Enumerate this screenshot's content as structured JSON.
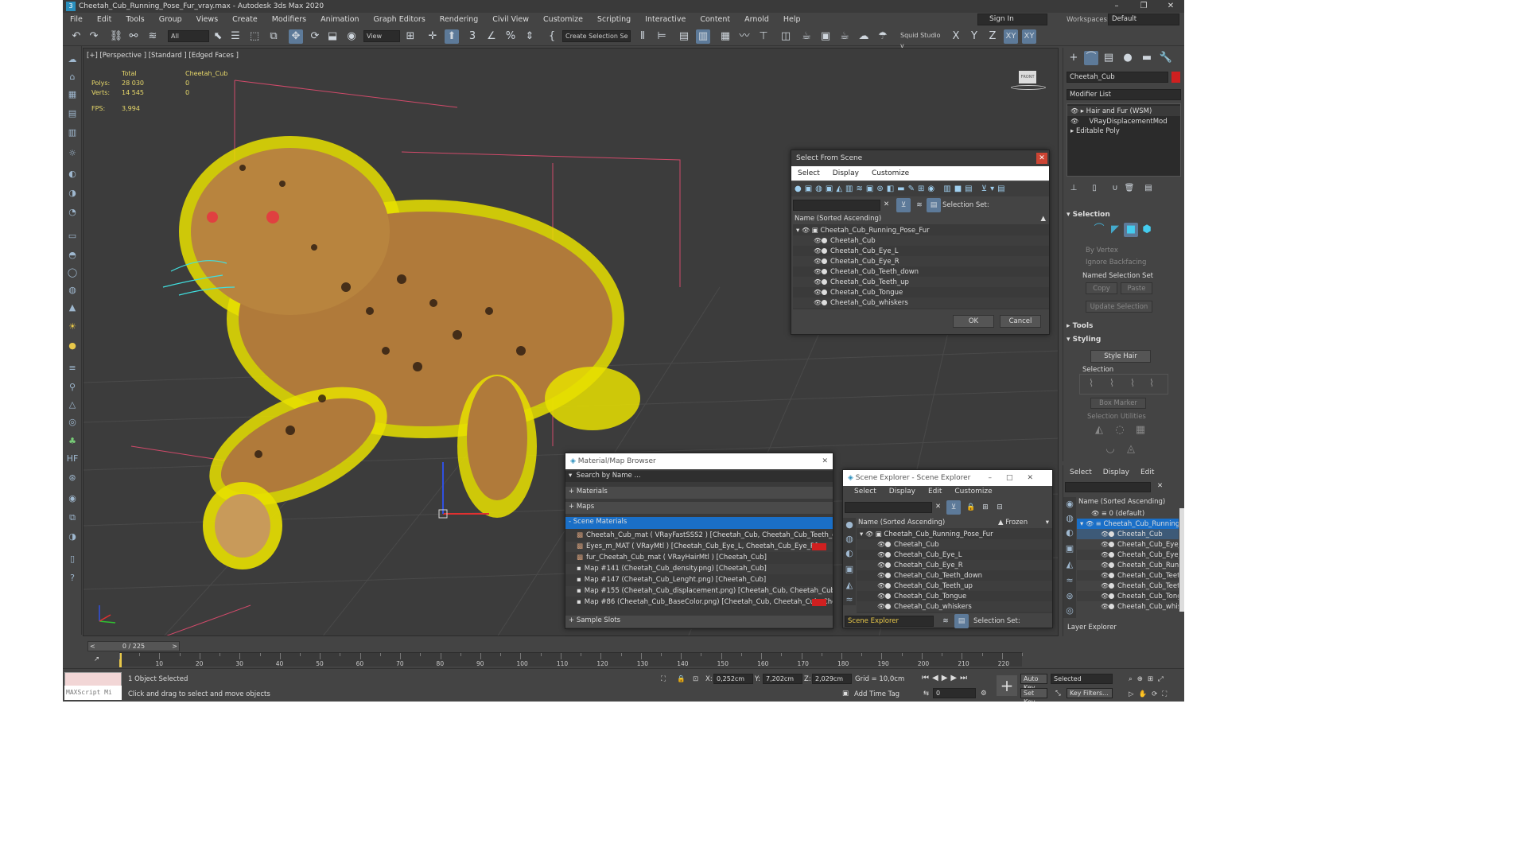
{
  "window": {
    "title": "Cheetah_Cub_Running_Pose_Fur_vray.max - Autodesk 3ds Max 2020",
    "min": "–",
    "max": "❐",
    "close": "✕"
  },
  "menu": [
    "File",
    "Edit",
    "Tools",
    "Group",
    "Views",
    "Create",
    "Modifiers",
    "Animation",
    "Graph Editors",
    "Rendering",
    "Civil View",
    "Customize",
    "Scripting",
    "Interactive",
    "Content",
    "Arnold",
    "Help"
  ],
  "account": {
    "signin": "Sign In",
    "workspaces_label": "Workspaces:",
    "workspace": "Default"
  },
  "toolbar": {
    "filter": "All",
    "refcoord": "View",
    "selset": "Create Selection Se",
    "squid": "Squid Studio v",
    "axes": [
      "X",
      "Y",
      "Z",
      "XY",
      "XY"
    ]
  },
  "viewport": {
    "label": "[+] [Perspective ] [Standard ] [Edged Faces ]",
    "stats": {
      "total_label": "Total",
      "object": "Cheetah_Cub",
      "polys_label": "Polys:",
      "polys_total": "28 030",
      "polys_obj": "0",
      "verts_label": "Verts:",
      "verts_total": "14 545",
      "verts_obj": "0",
      "fps_label": "FPS:",
      "fps": "3,994"
    },
    "viewcube": "FRONT"
  },
  "select_from_scene": {
    "title": "Select From Scene",
    "menu": [
      "Select",
      "Display",
      "Customize"
    ],
    "selection_set": "Selection Set:",
    "column": "Name (Sorted Ascending)",
    "root": "Cheetah_Cub_Running_Pose_Fur",
    "items": [
      "Cheetah_Cub",
      "Cheetah_Cub_Eye_L",
      "Cheetah_Cub_Eye_R",
      "Cheetah_Cub_Teeth_down",
      "Cheetah_Cub_Teeth_up",
      "Cheetah_Cub_Tongue",
      "Cheetah_Cub_whiskers"
    ],
    "ok": "OK",
    "cancel": "Cancel"
  },
  "material_browser": {
    "title": "Material/Map Browser",
    "search": "Search by Name ...",
    "sections": {
      "materials": "+ Materials",
      "maps": "+ Maps",
      "scene": "- Scene Materials",
      "samples": "+ Sample Slots"
    },
    "items": [
      "Cheetah_Cub_mat  ( VRayFastSSS2 )  [Cheetah_Cub, Cheetah_Cub_Teeth_do...",
      "Eyes_m_MAT  ( VRayMtl )  [Cheetah_Cub_Eye_L, Cheetah_Cub_Eye_R]",
      "fur_Cheetah_Cub_mat  ( VRayHairMtl )  [Cheetah_Cub]",
      "Map #141 (Cheetah_Cub_density.png)  [Cheetah_Cub]",
      "Map #147 (Cheetah_Cub_Lenght.png)  [Cheetah_Cub]",
      "Map #155 (Cheetah_Cub_displacement.png)  [Cheetah_Cub, Cheetah_Cub, C...",
      "Map #86 (Cheetah_Cub_BaseColor.png)  [Cheetah_Cub, Cheetah_Cub, Cheet..."
    ]
  },
  "scene_explorer": {
    "title": "Scene Explorer - Scene Explorer",
    "menu": [
      "Select",
      "Display",
      "Edit",
      "Customize"
    ],
    "column": "Name (Sorted Ascending)",
    "frozen": "▲ Frozen",
    "root": "Cheetah_Cub_Running_Pose_Fur",
    "items": [
      "Cheetah_Cub",
      "Cheetah_Cub_Eye_L",
      "Cheetah_Cub_Eye_R",
      "Cheetah_Cub_Teeth_down",
      "Cheetah_Cub_Teeth_up",
      "Cheetah_Cub_Tongue",
      "Cheetah_Cub_whiskers"
    ],
    "footer": "Scene Explorer",
    "selection_set": "Selection Set:"
  },
  "command_panel": {
    "object_name": "Cheetah_Cub",
    "modifier_list": "Modifier List",
    "stack": [
      "Hair and Fur (WSM)",
      "VRayDisplacementMod",
      "Editable Poly"
    ],
    "selection": "Selection",
    "by_vertex": "By Vertex",
    "ignore_backfacing": "Ignore Backfacing",
    "named_sel": "Named Selection Set",
    "copy": "Copy",
    "paste": "Paste",
    "update_sel": "Update Selection",
    "tools": "Tools",
    "styling": "Styling",
    "style_hair": "Style Hair",
    "selection2": "Selection",
    "box_marker": "Box Marker",
    "sel_utilities": "Selection Utilities"
  },
  "layer_explorer": {
    "menu": [
      "Select",
      "Display",
      "Edit"
    ],
    "column": "Name (Sorted Ascending)",
    "items": [
      "0 (default)",
      "Cheetah_Cub_Running",
      "Cheetah_Cub",
      "Cheetah_Cub_Eye_",
      "Cheetah_Cub_Eye_",
      "Cheetah_Cub_Runn",
      "Cheetah_Cub_Teet",
      "Cheetah_Cub_Teet",
      "Cheetah_Cub_Tong",
      "Cheetah_Cub_whisk"
    ],
    "footer": "Layer Explorer"
  },
  "timeline": {
    "frame": "0 / 225",
    "ticks": [
      "0",
      "10",
      "20",
      "30",
      "40",
      "50",
      "60",
      "70",
      "80",
      "90",
      "100",
      "110",
      "120",
      "130",
      "140",
      "150",
      "160",
      "170",
      "180",
      "190",
      "200",
      "210",
      "220"
    ]
  },
  "status": {
    "maxscript": "MAXScript Mi",
    "selected": "1 Object Selected",
    "hint": "Click and drag to select and move objects",
    "x_label": "X:",
    "x": "0,252cm",
    "y_label": "Y:",
    "y": "7,202cm",
    "z_label": "Z:",
    "z": "2,029cm",
    "grid": "Grid = 10,0cm",
    "add_time_tag": "Add Time Tag",
    "auto_key": "Auto Key",
    "set_key": "Set Key",
    "selected_dd": "Selected",
    "key_filters": "Key Filters...",
    "frame_field": "0"
  }
}
